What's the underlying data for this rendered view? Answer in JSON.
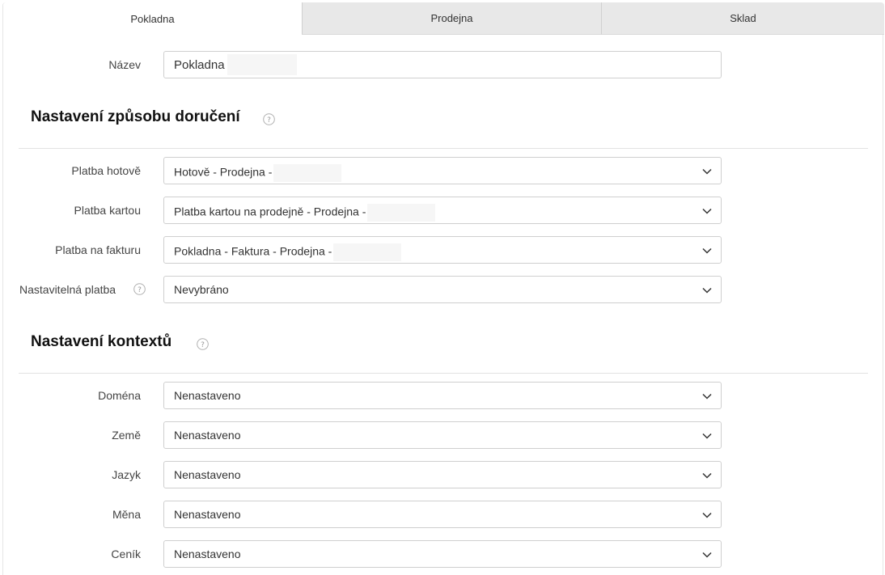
{
  "tabs": [
    {
      "label": "Pokladna",
      "active": true
    },
    {
      "label": "Prodejna",
      "active": false
    },
    {
      "label": "Sklad",
      "active": false
    }
  ],
  "name_field": {
    "label": "Název",
    "value": "Pokladna"
  },
  "delivery_section": {
    "title": "Nastavení způsobu doručení",
    "rows": [
      {
        "label": "Platba hotově",
        "value": "Hotově - Prodejna -"
      },
      {
        "label": "Platba kartou",
        "value": "Platba kartou na prodejně - Prodejna -"
      },
      {
        "label": "Platba na fakturu",
        "value": "Pokladna - Faktura - Prodejna -"
      },
      {
        "label": "Nastavitelná platba",
        "value": "Nevybráno"
      }
    ]
  },
  "context_section": {
    "title": "Nastavení kontextů",
    "rows": [
      {
        "label": "Doména",
        "value": "Nenastaveno"
      },
      {
        "label": "Země",
        "value": "Nenastaveno"
      },
      {
        "label": "Jazyk",
        "value": "Nenastaveno"
      },
      {
        "label": "Měna",
        "value": "Nenastaveno"
      },
      {
        "label": "Ceník",
        "value": "Nenastaveno"
      }
    ]
  },
  "colors": {
    "tab_inactive": "#e8e8e8",
    "border": "#cfcfcf",
    "text": "#333333"
  },
  "icons": {
    "help": "question-circle-icon",
    "select": "chevron-down-icon"
  }
}
